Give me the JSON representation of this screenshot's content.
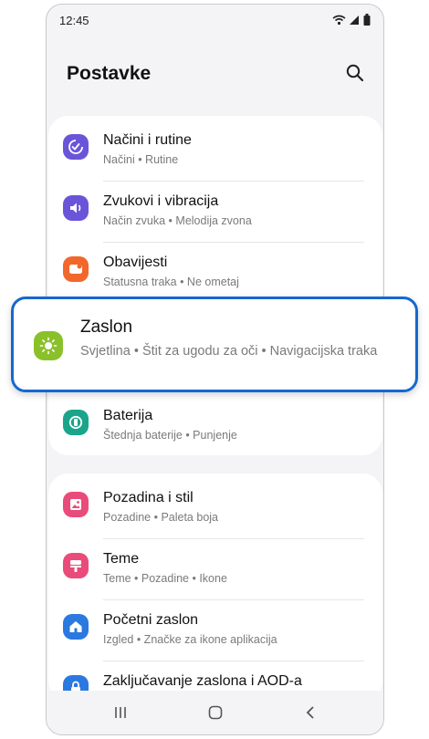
{
  "status": {
    "time": "12:45"
  },
  "header": {
    "title": "Postavke"
  },
  "group1": [
    {
      "title": "Načini i rutine",
      "sub": "Načini  •  Rutine",
      "color": "#6a55d9"
    },
    {
      "title": "Zvukovi i vibracija",
      "sub": "Način zvuka  •  Melodija zvona",
      "color": "#6a55d9"
    },
    {
      "title": "Obavijesti",
      "sub": "Statusna traka  •  Ne ometaj",
      "color": "#f2672b"
    },
    {
      "title": "Zaslon",
      "sub": "Svjetlina  •  Štit za ugodu za oči  •  Navigacijska traka",
      "color": "#8ac12b"
    },
    {
      "title": "Baterija",
      "sub": "Štednja baterije  •  Punjenje",
      "color": "#1aa58a"
    }
  ],
  "group2": [
    {
      "title": "Pozadina i stil",
      "sub": "Pozadine  •  Paleta boja",
      "color": "#e94b7a"
    },
    {
      "title": "Teme",
      "sub": "Teme  •  Pozadine  •  Ikone",
      "color": "#e94b7a"
    },
    {
      "title": "Početni zaslon",
      "sub": "Izgled  •  Značke za ikone aplikacija",
      "color": "#2a78e0"
    },
    {
      "title": "Zaključavanje zaslona i AOD-a",
      "sub": "",
      "color": "#2a78e0"
    }
  ],
  "icons": {
    "modes": "modes-routines-icon",
    "sound": "sound-icon",
    "notif": "notifications-icon",
    "display": "display-sun-icon",
    "battery": "battery-icon",
    "wallpaper": "wallpaper-icon",
    "themes": "themes-icon",
    "home": "home-icon",
    "lock": "lock-icon"
  }
}
